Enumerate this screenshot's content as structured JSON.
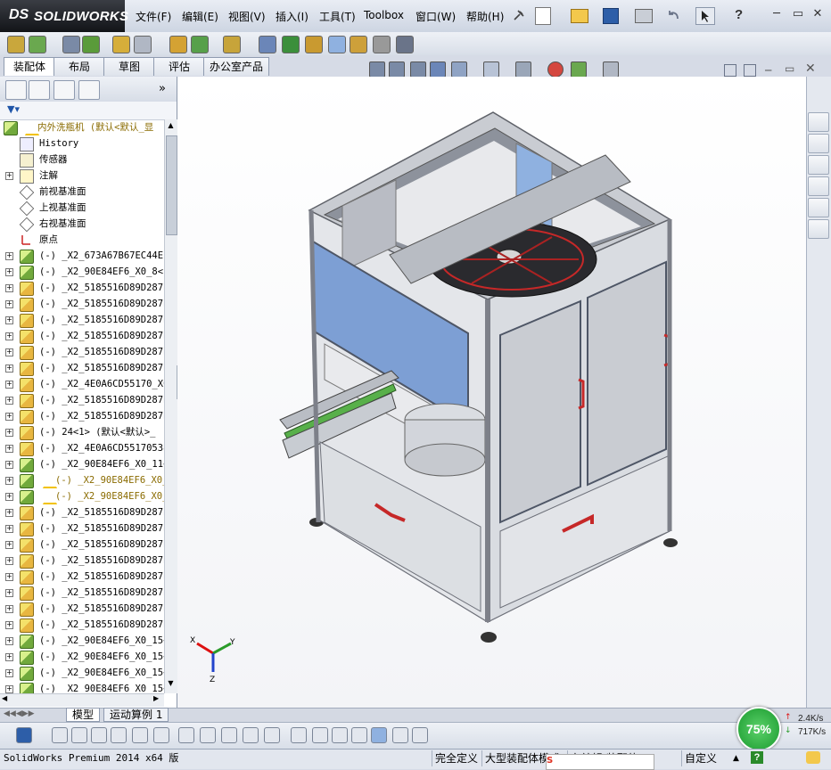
{
  "app": {
    "logo_ds": "DS",
    "logo_name": "SOLIDWORKS"
  },
  "menu": [
    "文件(F)",
    "编辑(E)",
    "视图(V)",
    "插入(I)",
    "工具(T)",
    "Toolbox",
    "窗口(W)",
    "帮助(H)"
  ],
  "command_tabs": [
    "装配体",
    "布局",
    "草图",
    "评估",
    "办公室产品"
  ],
  "active_tab": "装配体",
  "feature_tree": {
    "root_label": "内外洗瓶机  (默认<默认_显",
    "items": [
      {
        "type": "history",
        "label": "History",
        "expand": false
      },
      {
        "type": "sensor",
        "label": "传感器",
        "expand": false
      },
      {
        "type": "annotation",
        "label": "注解",
        "expand": true
      },
      {
        "type": "plane",
        "label": "前视基准面",
        "expand": false
      },
      {
        "type": "plane",
        "label": "上视基准面",
        "expand": false
      },
      {
        "type": "plane",
        "label": "右视基准面",
        "expand": false
      },
      {
        "type": "origin",
        "label": "原点",
        "expand": false
      },
      {
        "type": "asm",
        "label": "(-) _X2_673A67B67EC44EF",
        "expand": true
      },
      {
        "type": "asm",
        "label": "(-) _X2_90E84EF6_X0_8<1",
        "expand": true
      },
      {
        "type": "part",
        "label": "(-) _X2_5185516D89D287B",
        "expand": true
      },
      {
        "type": "part",
        "label": "(-) _X2_5185516D89D287B",
        "expand": true
      },
      {
        "type": "part",
        "label": "(-) _X2_5185516D89D287B",
        "expand": true
      },
      {
        "type": "part",
        "label": "(-) _X2_5185516D89D287B",
        "expand": true
      },
      {
        "type": "part",
        "label": "(-) _X2_5185516D89D287B",
        "expand": true
      },
      {
        "type": "part",
        "label": "(-) _X2_5185516D89D287B",
        "expand": true
      },
      {
        "type": "part",
        "label": "(-) _X2_4E0A6CD55170_X0",
        "expand": true
      },
      {
        "type": "part",
        "label": "(-) _X2_5185516D89D287B",
        "expand": true
      },
      {
        "type": "part",
        "label": "(-) _X2_5185516D89D287B",
        "expand": true
      },
      {
        "type": "part",
        "label": "(-) 24<1> (默认<默认>_",
        "expand": true
      },
      {
        "type": "part",
        "label": "(-) _X2_4E0A6CD55170538",
        "expand": true
      },
      {
        "type": "asm",
        "label": "(-) _X2_90E84EF6_X0_11<",
        "expand": true
      },
      {
        "type": "asm-warn",
        "label": "(-) _X2_90E84EF6_X0_",
        "expand": true
      },
      {
        "type": "asm-warn",
        "label": "(-) _X2_90E84EF6_X0_",
        "expand": true
      },
      {
        "type": "part",
        "label": "(-) _X2_5185516D89D287B",
        "expand": true
      },
      {
        "type": "part",
        "label": "(-) _X2_5185516D89D287B",
        "expand": true
      },
      {
        "type": "part",
        "label": "(-) _X2_5185516D89D287B",
        "expand": true
      },
      {
        "type": "part",
        "label": "(-) _X2_5185516D89D287B",
        "expand": true
      },
      {
        "type": "part",
        "label": "(-) _X2_5185516D89D287B",
        "expand": true
      },
      {
        "type": "part",
        "label": "(-) _X2_5185516D89D287B",
        "expand": true
      },
      {
        "type": "part",
        "label": "(-) _X2_5185516D89D287B",
        "expand": true
      },
      {
        "type": "part",
        "label": "(-) _X2_5185516D89D287B",
        "expand": true
      },
      {
        "type": "asm",
        "label": "(-) _X2_90E84EF6_X0_15<",
        "expand": true
      },
      {
        "type": "asm",
        "label": "(-) _X2_90E84EF6_X0_15<",
        "expand": true
      },
      {
        "type": "asm",
        "label": "(-) _X2_90E84EF6_X0_15<",
        "expand": true
      },
      {
        "type": "asm",
        "label": "(-) _X2_90E84EF6_X0_15<",
        "expand": true
      }
    ]
  },
  "bottom_tabs": [
    "模型",
    "运动算例 1"
  ],
  "status": {
    "product": "SolidWorks Premium 2014 x64 版",
    "definition": "完全定义",
    "mode": "大型装配体模式",
    "editing": "在编辑 装配体",
    "custom": "自定义"
  },
  "network": {
    "percent": "75%",
    "up": "2.4K/s",
    "down": "717K/s"
  },
  "triad": {
    "x": "X",
    "y": "Y",
    "z": "Z"
  }
}
